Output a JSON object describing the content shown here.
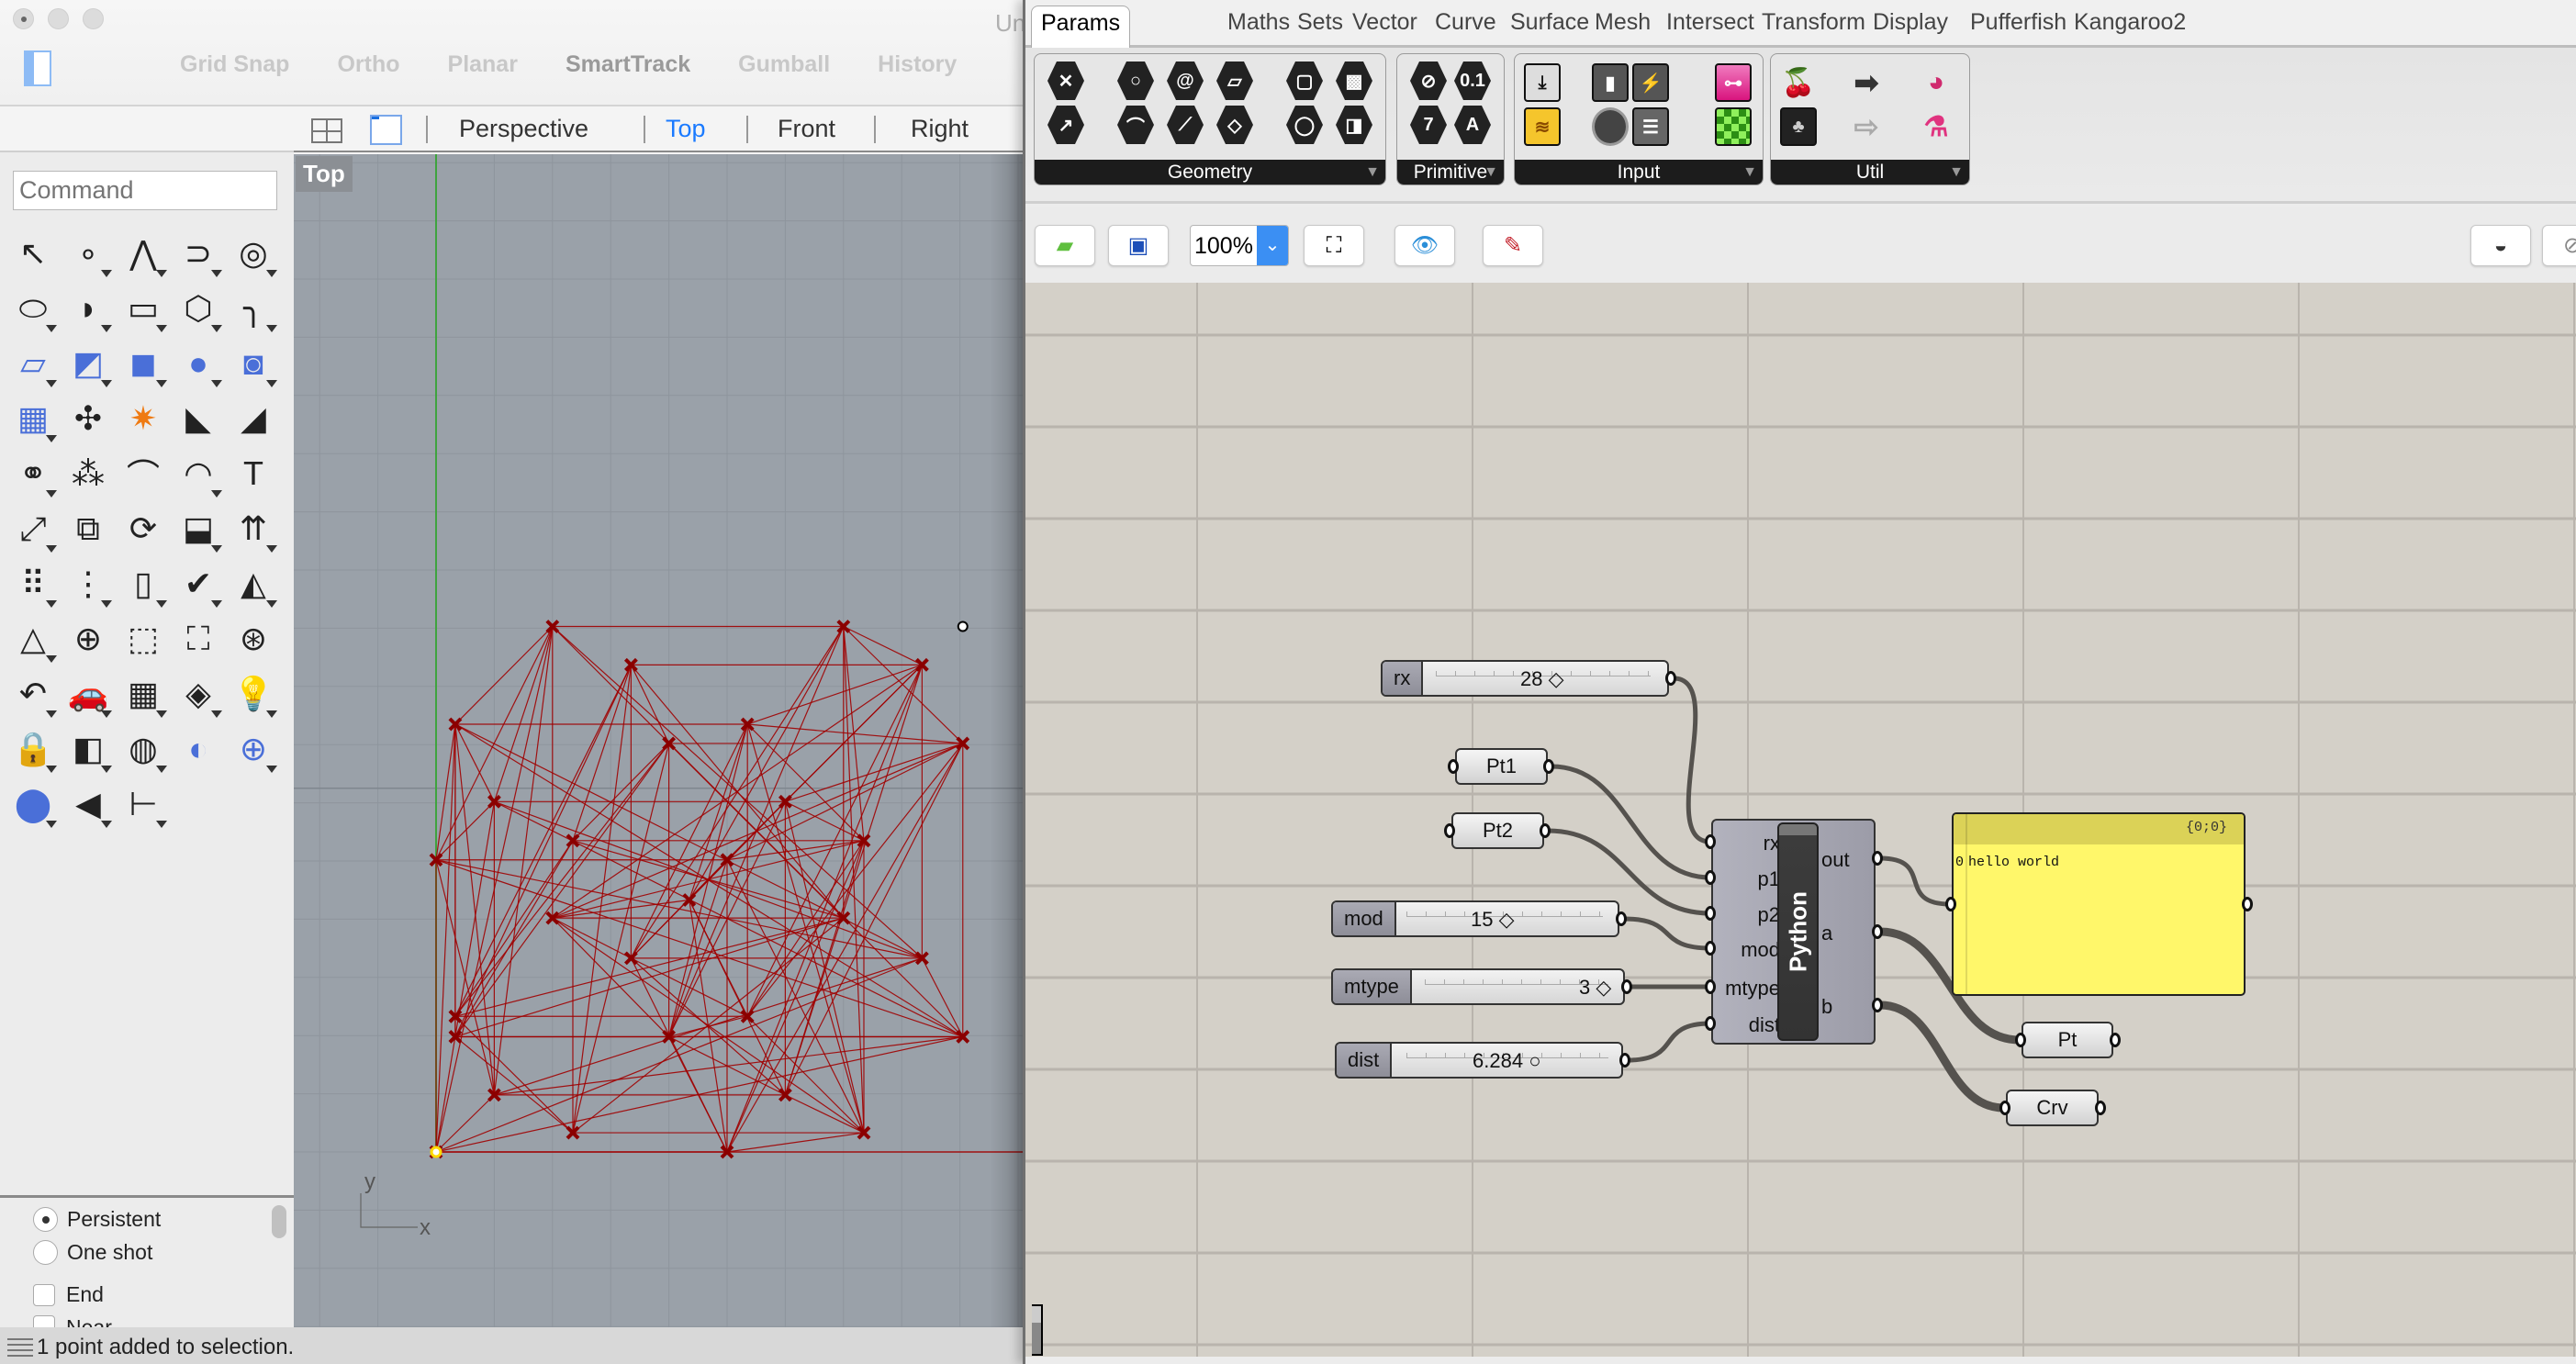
{
  "rhino": {
    "window_title": "Un",
    "modes": [
      {
        "label": "Grid Snap",
        "on": false
      },
      {
        "label": "Ortho",
        "on": false
      },
      {
        "label": "Planar",
        "on": false
      },
      {
        "label": "SmartTrack",
        "on": true
      },
      {
        "label": "Gumball",
        "on": false
      },
      {
        "label": "History",
        "on": false
      }
    ],
    "view_tabs": [
      "Perspective",
      "Top",
      "Front",
      "Right"
    ],
    "active_view_tab": "Top",
    "command_placeholder": "Command",
    "tools": [
      {
        "name": "select",
        "glyph": "↖",
        "flyout": false
      },
      {
        "name": "point",
        "glyph": "∘",
        "flyout": true
      },
      {
        "name": "polyline",
        "glyph": "⋀",
        "flyout": true
      },
      {
        "name": "curve",
        "glyph": "⊃",
        "flyout": true
      },
      {
        "name": "circle",
        "glyph": "◎",
        "flyout": true
      },
      {
        "name": "ellipse",
        "glyph": "⬭",
        "flyout": true
      },
      {
        "name": "arc",
        "glyph": "◗",
        "flyout": true
      },
      {
        "name": "rectangle",
        "glyph": "▭",
        "flyout": true
      },
      {
        "name": "polygon",
        "glyph": "⬡",
        "flyout": true
      },
      {
        "name": "fillet-curves",
        "glyph": "╮",
        "flyout": true
      },
      {
        "name": "surface-from-points",
        "glyph": "▱",
        "flyout": true
      },
      {
        "name": "extrude-surface",
        "glyph": "◩",
        "flyout": true
      },
      {
        "name": "box",
        "glyph": "◼",
        "flyout": true
      },
      {
        "name": "spheres",
        "glyph": "●",
        "flyout": true
      },
      {
        "name": "cylinder-solid",
        "glyph": "◙",
        "flyout": true
      },
      {
        "name": "surface-tools",
        "glyph": "▦",
        "flyout": true
      },
      {
        "name": "join",
        "glyph": "✣",
        "flyout": false
      },
      {
        "name": "explode",
        "glyph": "✷",
        "flyout": false
      },
      {
        "name": "trim",
        "glyph": "◣",
        "flyout": false
      },
      {
        "name": "split",
        "glyph": "◢",
        "flyout": false
      },
      {
        "name": "boolean-union",
        "glyph": "⚭",
        "flyout": true
      },
      {
        "name": "group",
        "glyph": "⁂",
        "flyout": false
      },
      {
        "name": "offset-curve",
        "glyph": "⌒",
        "flyout": false
      },
      {
        "name": "offset-dotted",
        "glyph": "◠",
        "flyout": true
      },
      {
        "name": "text",
        "glyph": "T",
        "flyout": false
      },
      {
        "name": "move",
        "glyph": "⤢",
        "flyout": true
      },
      {
        "name": "copy",
        "glyph": "⧉",
        "flyout": false
      },
      {
        "name": "rotate",
        "glyph": "⟳",
        "flyout": false
      },
      {
        "name": "scale",
        "glyph": "⬓",
        "flyout": true
      },
      {
        "name": "project-to-cplane",
        "glyph": "⇈",
        "flyout": true
      },
      {
        "name": "array",
        "glyph": "⠿",
        "flyout": true
      },
      {
        "name": "align",
        "glyph": "⋮",
        "flyout": true
      },
      {
        "name": "bend",
        "glyph": "▯",
        "flyout": true
      },
      {
        "name": "check",
        "glyph": "✔",
        "flyout": true
      },
      {
        "name": "solids",
        "glyph": "◭",
        "flyout": true
      },
      {
        "name": "select-by",
        "glyph": "△",
        "flyout": true
      },
      {
        "name": "zoom-in-out",
        "glyph": "⊕",
        "flyout": false
      },
      {
        "name": "zoom-window",
        "glyph": "⬚",
        "flyout": false
      },
      {
        "name": "zoom-extents",
        "glyph": "⛶",
        "flyout": false
      },
      {
        "name": "zoom-selected",
        "glyph": "⊛",
        "flyout": false
      },
      {
        "name": "rotate-view",
        "glyph": "↶",
        "flyout": true
      },
      {
        "name": "named-view",
        "glyph": "🚗",
        "flyout": true
      },
      {
        "name": "cplane",
        "glyph": "▦",
        "flyout": true
      },
      {
        "name": "layout",
        "glyph": "◈",
        "flyout": true
      },
      {
        "name": "light",
        "glyph": "💡",
        "flyout": true
      },
      {
        "name": "lock",
        "glyph": "🔒",
        "flyout": true
      },
      {
        "name": "layers",
        "glyph": "◧",
        "flyout": true
      },
      {
        "name": "color",
        "glyph": "◍",
        "flyout": true
      },
      {
        "name": "render-sphere",
        "glyph": "◐",
        "flyout": false
      },
      {
        "name": "render-grid-sphere",
        "glyph": "⊕",
        "flyout": true
      },
      {
        "name": "material",
        "glyph": "⬤",
        "flyout": true
      },
      {
        "name": "spotlight",
        "glyph": "◀",
        "flyout": true
      },
      {
        "name": "dimension",
        "glyph": "⊢",
        "flyout": true
      }
    ],
    "osnap": {
      "radios": [
        {
          "label": "Persistent",
          "checked": true
        },
        {
          "label": "One shot",
          "checked": false
        }
      ],
      "checks": [
        {
          "label": "End",
          "checked": false
        },
        {
          "label": "Near",
          "checked": false
        }
      ]
    },
    "status_text": "1 point added to selection.",
    "viewport": {
      "label": "Top",
      "axis_labels": {
        "x": "x",
        "y": "y"
      },
      "grid_spacing_units": 1,
      "points": [
        [
          0.0,
          0.0
        ],
        [
          5.0,
          0.0
        ],
        [
          2.35,
          0.33
        ],
        [
          7.35,
          0.33
        ],
        [
          1.0,
          0.98
        ],
        [
          6.0,
          0.98
        ],
        [
          0.33,
          1.98
        ],
        [
          4.0,
          1.98
        ],
        [
          9.05,
          1.98
        ],
        [
          5.35,
          2.33
        ],
        [
          0.33,
          2.33
        ],
        [
          3.35,
          3.33
        ],
        [
          8.35,
          3.33
        ],
        [
          2.0,
          4.02
        ],
        [
          7.0,
          4.02
        ],
        [
          4.35,
          4.33
        ],
        [
          0.0,
          5.02
        ],
        [
          5.0,
          5.02
        ],
        [
          2.35,
          5.35
        ],
        [
          7.35,
          5.35
        ],
        [
          1.0,
          6.02
        ],
        [
          6.0,
          6.02
        ],
        [
          4.0,
          7.02
        ],
        [
          9.05,
          7.02
        ],
        [
          0.33,
          7.35
        ],
        [
          5.35,
          7.35
        ],
        [
          3.35,
          8.37
        ],
        [
          8.35,
          8.37
        ],
        [
          2.0,
          9.03
        ],
        [
          7.0,
          9.03
        ]
      ],
      "selected_point": [
        9.05,
        9.03
      ],
      "origin_point_highlight": [
        0.0,
        0.0
      ],
      "curve_color": "#a00000",
      "point_color": "#8b0000",
      "connection_modulus": 15
    }
  },
  "grasshopper": {
    "tabs": [
      "Params",
      "Maths",
      "Sets",
      "Vector",
      "Curve",
      "Surface",
      "Mesh",
      "Intersect",
      "Transform",
      "Display",
      "Pufferfish",
      "Kangaroo2"
    ],
    "active_tab": "Params",
    "ribbon_groups": [
      {
        "label": "Geometry",
        "icons": [
          "geometry-icon",
          "circle-icon",
          "curve-icon",
          "surface-icon",
          "brep-icon",
          "mesh-icon",
          "vector-icon",
          "arc-icon",
          "line-icon",
          "plane-icon",
          "box-icon",
          "mesh-face-icon"
        ]
      },
      {
        "label": "Primitive",
        "icons": [
          "boolean-icon",
          "number-icon",
          "integer-icon",
          "text-icon"
        ]
      },
      {
        "label": "Input",
        "icons": [
          "import-icon",
          "toggle-icon",
          "button-icon",
          "gradient-icon",
          "graph-mapper-icon",
          "dial-icon",
          "value-list-icon",
          "colour-swatch-icon"
        ]
      },
      {
        "label": "Util",
        "icons": [
          "cherry-picker-icon",
          "relay-icon",
          "data-dam-icon",
          "tree-icon",
          "relay-outline-icon",
          "flask-icon"
        ]
      }
    ],
    "toolbar": {
      "zoom_level": "100%"
    },
    "sliders": [
      {
        "name": "rx",
        "value": "28",
        "marker": "◇",
        "fraction": 0.5
      },
      {
        "name": "mod",
        "value": "15",
        "marker": "◇",
        "fraction": 0.5
      },
      {
        "name": "mtype",
        "value": "3",
        "marker": "◇",
        "fraction": 1.0
      },
      {
        "name": "dist",
        "value": "6.284",
        "marker": "○",
        "fraction": 0.5
      }
    ],
    "params": [
      {
        "name": "Pt1"
      },
      {
        "name": "Pt2"
      },
      {
        "name": "Pt"
      },
      {
        "name": "Crv"
      }
    ],
    "python_component": {
      "label": "Python",
      "inputs": [
        "rx",
        "p1",
        "p2",
        "mod",
        "mtype",
        "dist"
      ],
      "outputs": [
        "out",
        "a",
        "b"
      ]
    },
    "panel": {
      "path": "{0;0}",
      "index": "0",
      "text": "hello world"
    },
    "colors": {
      "canvas": "#d4d0c8",
      "wire": "#55524e",
      "panel": "#fff76a"
    }
  }
}
